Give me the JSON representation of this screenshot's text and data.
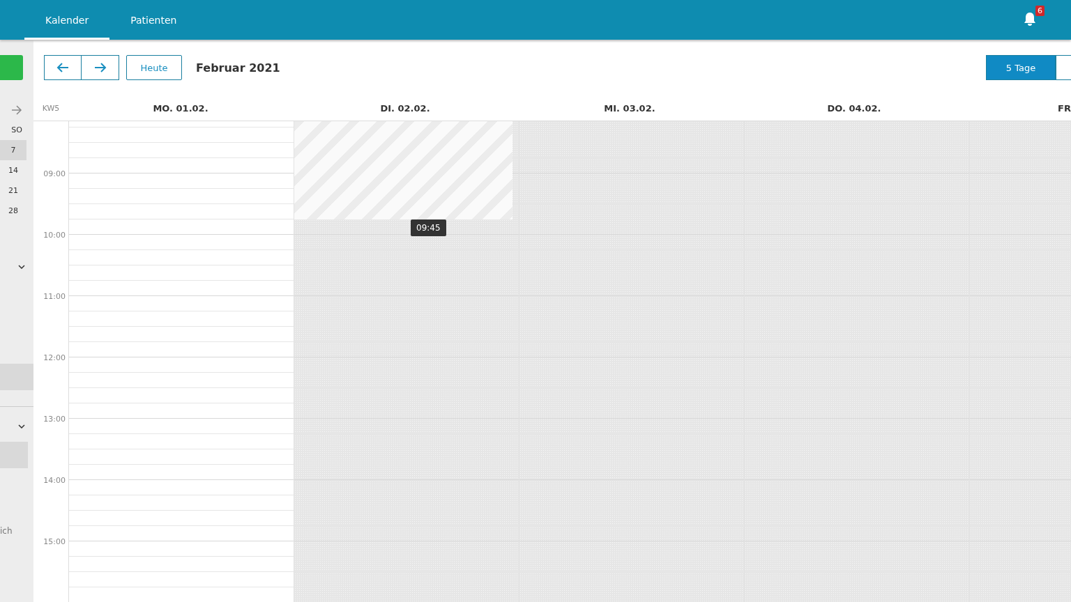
{
  "nav": {
    "tabs": [
      {
        "label": "Kalender",
        "selected": true
      },
      {
        "label": "Patienten",
        "selected": false
      }
    ],
    "notifications": "6"
  },
  "sidebar": {
    "weekday": "SO",
    "dates": [
      {
        "label": "7",
        "selected": true
      },
      {
        "label": "14",
        "selected": false
      },
      {
        "label": "21",
        "selected": false
      },
      {
        "label": "28",
        "selected": false
      }
    ],
    "cut_text": "ich"
  },
  "toolbar": {
    "today": "Heute",
    "title": "Februar 2021",
    "views": [
      {
        "label": "5 Tage",
        "selected": true
      },
      {
        "selected": false
      }
    ]
  },
  "calendar": {
    "week": "KW5",
    "days": [
      {
        "label": "MO. 01.02.",
        "shaded": false
      },
      {
        "label": "DI. 02.02.",
        "shaded": true,
        "selection": {
          "tooltip": "09:45"
        }
      },
      {
        "label": "MI. 03.02.",
        "shaded": true
      },
      {
        "label": "DO. 04.02.",
        "shaded": true
      },
      {
        "label": "FR",
        "shaded": true
      }
    ],
    "hours": [
      "09:00",
      "10:00",
      "11:00",
      "12:00",
      "13:00",
      "14:00",
      "15:00"
    ]
  }
}
